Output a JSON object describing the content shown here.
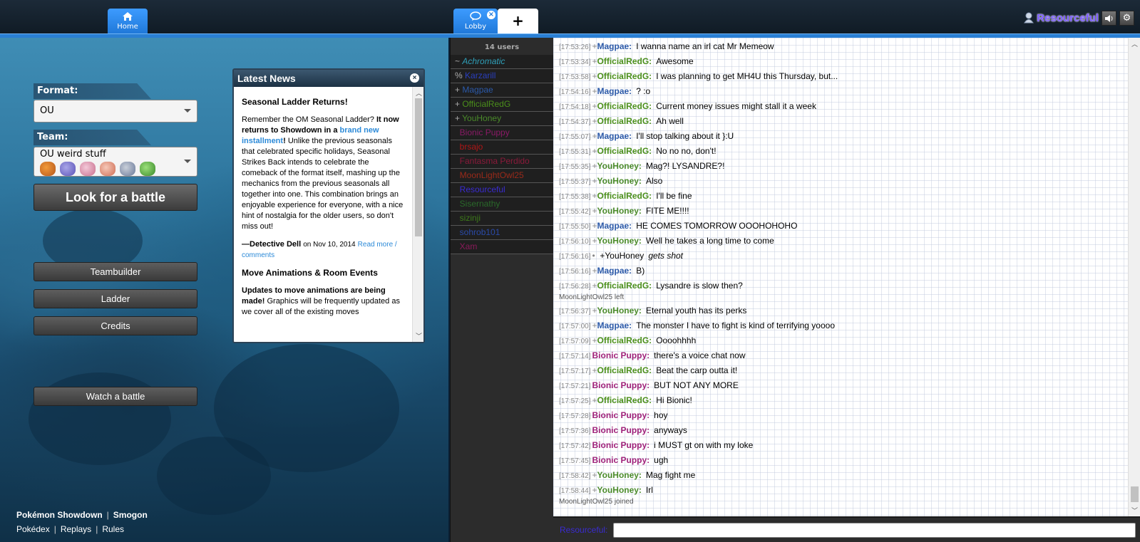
{
  "header": {
    "tabs": [
      {
        "label": "Home"
      },
      {
        "label": "Lobby"
      }
    ],
    "plus_label": "+",
    "user": "Resourceful"
  },
  "home": {
    "format_label": "Format:",
    "format_value": "OU",
    "team_label": "Team:",
    "team_value": "OU weird stuff",
    "battle_button": "Look for a battle",
    "menu": [
      "Teambuilder",
      "Ladder",
      "Credits"
    ],
    "watch_button": "Watch a battle",
    "footer_row1": [
      "Pokémon Showdown",
      "Smogon"
    ],
    "footer_row2": [
      "Pokédex",
      "Replays",
      "Rules"
    ]
  },
  "news": {
    "heading": "Latest News",
    "item1_title": "Seasonal Ladder Returns!",
    "item1_p1_a": "Remember the OM Seasonal Ladder?",
    "item1_p1_b": "It now returns to Showdown in a",
    "item1_p1_link": "brand new installment",
    "item1_p1_c": "!",
    "item1_p1_d": "Unlike the previous seasonals that celebrated specific holidays, Seasonal Strikes Back intends to celebrate the comeback of the format itself, mashing up the mechanics from the previous seasonals all together into one. This combination brings an enjoyable experience for everyone, with a nice hint of nostalgia for the older users, so don't miss out!",
    "item1_author": "—Detective Dell",
    "item1_date": "on Nov 10, 2014",
    "item1_readmore": "Read more / comments",
    "item2_title": "Move Animations & Room Events",
    "item2_bold": "Updates to move animations are being made!",
    "item2_text": "Graphics will be frequently updated as we cover all of the existing moves"
  },
  "userlist": {
    "count": "14 users",
    "users": [
      {
        "grp": "~",
        "name": "Achromatic",
        "color": "#2f9fb8",
        "italic": true
      },
      {
        "grp": "%",
        "name": "Karzarill",
        "color": "#2a3fbf",
        "italic": false
      },
      {
        "grp": "+",
        "name": "Magpae",
        "color": "#2b59a8",
        "italic": false
      },
      {
        "grp": "+",
        "name": "OfficialRedG",
        "color": "#4b8f1b",
        "italic": false
      },
      {
        "grp": "+",
        "name": "YouHoney",
        "color": "#4a8a2a",
        "italic": false
      },
      {
        "grp": "",
        "name": "Bionic Puppy",
        "color": "#8a1a66",
        "italic": false
      },
      {
        "grp": "",
        "name": "brsajo",
        "color": "#b01616",
        "italic": false
      },
      {
        "grp": "",
        "name": "Fantasma Perdido",
        "color": "#8a1a3a",
        "italic": false
      },
      {
        "grp": "",
        "name": "MoonLightOwl25",
        "color": "#9a2a1a",
        "italic": false
      },
      {
        "grp": "",
        "name": "Resourceful",
        "color": "#3a2bd1",
        "italic": false
      },
      {
        "grp": "",
        "name": "Sisernathy",
        "color": "#2a6a2a",
        "italic": false
      },
      {
        "grp": "",
        "name": "sizinji",
        "color": "#3d7a1a",
        "italic": false
      },
      {
        "grp": "",
        "name": "sohrob101",
        "color": "#2a4aa8",
        "italic": false
      },
      {
        "grp": "",
        "name": "Xam",
        "color": "#8a1a5a",
        "italic": false
      }
    ]
  },
  "chat": {
    "messages": [
      {
        "type": "msg",
        "ts": "[17:53:26]",
        "grp": "+",
        "nick": "Magpae:",
        "color": "#2b59a8",
        "text": "I wanna name an irl cat Mr Memeow"
      },
      {
        "type": "msg",
        "ts": "[17:53:34]",
        "grp": "+",
        "nick": "OfficialRedG:",
        "color": "#4b8f1b",
        "text": "Awesome"
      },
      {
        "type": "msg",
        "ts": "[17:53:58]",
        "grp": "+",
        "nick": "OfficialRedG:",
        "color": "#4b8f1b",
        "text": "I was planning to get MH4U this Thursday, but..."
      },
      {
        "type": "msg",
        "ts": "[17:54:16]",
        "grp": "+",
        "nick": "Magpae:",
        "color": "#2b59a8",
        "text": "? :o"
      },
      {
        "type": "msg",
        "ts": "[17:54:18]",
        "grp": "+",
        "nick": "OfficialRedG:",
        "color": "#4b8f1b",
        "text": "Current money issues might stall it a week"
      },
      {
        "type": "msg",
        "ts": "[17:54:37]",
        "grp": "+",
        "nick": "OfficialRedG:",
        "color": "#4b8f1b",
        "text": "Ah well"
      },
      {
        "type": "msg",
        "ts": "[17:55:07]",
        "grp": "+",
        "nick": "Magpae:",
        "color": "#2b59a8",
        "text": "I'll stop talking about it }:U"
      },
      {
        "type": "msg",
        "ts": "[17:55:31]",
        "grp": "+",
        "nick": "OfficialRedG:",
        "color": "#4b8f1b",
        "text": "No no no, don't!"
      },
      {
        "type": "msg",
        "ts": "[17:55:35]",
        "grp": "+",
        "nick": "YouHoney:",
        "color": "#4a8a2a",
        "text": "Mag?! LYSANDRE?!"
      },
      {
        "type": "msg",
        "ts": "[17:55:37]",
        "grp": "+",
        "nick": "YouHoney:",
        "color": "#4a8a2a",
        "text": "Also"
      },
      {
        "type": "msg",
        "ts": "[17:55:38]",
        "grp": "+",
        "nick": "OfficialRedG:",
        "color": "#4b8f1b",
        "text": "I'll be fine"
      },
      {
        "type": "msg",
        "ts": "[17:55:42]",
        "grp": "+",
        "nick": "YouHoney:",
        "color": "#4a8a2a",
        "text": "FITE ME!!!!"
      },
      {
        "type": "msg",
        "ts": "[17:55:50]",
        "grp": "+",
        "nick": "Magpae:",
        "color": "#2b59a8",
        "text": "HE COMES TOMORROW OOOHOHOHO"
      },
      {
        "type": "msg",
        "ts": "[17:56:10]",
        "grp": "+",
        "nick": "YouHoney:",
        "color": "#4a8a2a",
        "text": "Well he takes a long time to come"
      },
      {
        "type": "action",
        "ts": "[17:56:16]",
        "grp": "•",
        "nick": "+YouHoney",
        "color": "#000",
        "text": "gets shot"
      },
      {
        "type": "msg",
        "ts": "[17:56:16]",
        "grp": "+",
        "nick": "Magpae:",
        "color": "#2b59a8",
        "text": "B)"
      },
      {
        "type": "msg",
        "ts": "[17:56:28]",
        "grp": "+",
        "nick": "OfficialRedG:",
        "color": "#4b8f1b",
        "text": "Lysandre is slow then?"
      },
      {
        "type": "sys",
        "text": "MoonLightOwl25 left"
      },
      {
        "type": "msg",
        "ts": "[17:56:37]",
        "grp": "+",
        "nick": "YouHoney:",
        "color": "#4a8a2a",
        "text": "Eternal youth has its perks"
      },
      {
        "type": "msg",
        "ts": "[17:57:00]",
        "grp": "+",
        "nick": "Magpae:",
        "color": "#2b59a8",
        "text": "The monster I have to fight is kind of terrifying yoooo"
      },
      {
        "type": "msg",
        "ts": "[17:57:09]",
        "grp": "+",
        "nick": "OfficialRedG:",
        "color": "#4b8f1b",
        "text": "Oooohhhh"
      },
      {
        "type": "msg",
        "ts": "[17:57:14]",
        "grp": "",
        "nick": "Bionic Puppy:",
        "color": "#a0227a",
        "text": "there's a voice chat now"
      },
      {
        "type": "msg",
        "ts": "[17:57:17]",
        "grp": "+",
        "nick": "OfficialRedG:",
        "color": "#4b8f1b",
        "text": "Beat the carp outta it!"
      },
      {
        "type": "msg",
        "ts": "[17:57:21]",
        "grp": "",
        "nick": "Bionic Puppy:",
        "color": "#a0227a",
        "text": "BUT NOT ANY MORE"
      },
      {
        "type": "msg",
        "ts": "[17:57:25]",
        "grp": "+",
        "nick": "OfficialRedG:",
        "color": "#4b8f1b",
        "text": "Hi Bionic!"
      },
      {
        "type": "msg",
        "ts": "[17:57:28]",
        "grp": "",
        "nick": "Bionic Puppy:",
        "color": "#a0227a",
        "text": "hoy"
      },
      {
        "type": "msg",
        "ts": "[17:57:36]",
        "grp": "",
        "nick": "Bionic Puppy:",
        "color": "#a0227a",
        "text": "anyways"
      },
      {
        "type": "msg",
        "ts": "[17:57:42]",
        "grp": "",
        "nick": "Bionic Puppy:",
        "color": "#a0227a",
        "text": "i MUST gt on with my loke"
      },
      {
        "type": "msg",
        "ts": "[17:57:45]",
        "grp": "",
        "nick": "Bionic Puppy:",
        "color": "#a0227a",
        "text": "ugh"
      },
      {
        "type": "msg",
        "ts": "[17:58:42]",
        "grp": "+",
        "nick": "YouHoney:",
        "color": "#4a8a2a",
        "text": "Mag fight me"
      },
      {
        "type": "msg",
        "ts": "[17:58:44]",
        "grp": "+",
        "nick": "YouHoney:",
        "color": "#4a8a2a",
        "text": "Irl"
      },
      {
        "type": "sys",
        "text": "MoonLightOwl25 joined"
      }
    ],
    "input_user": "Resourceful:",
    "input_value": ""
  },
  "colors": {
    "tab_blue": "#2a7fd4",
    "user_purple": "#7b5cff"
  }
}
